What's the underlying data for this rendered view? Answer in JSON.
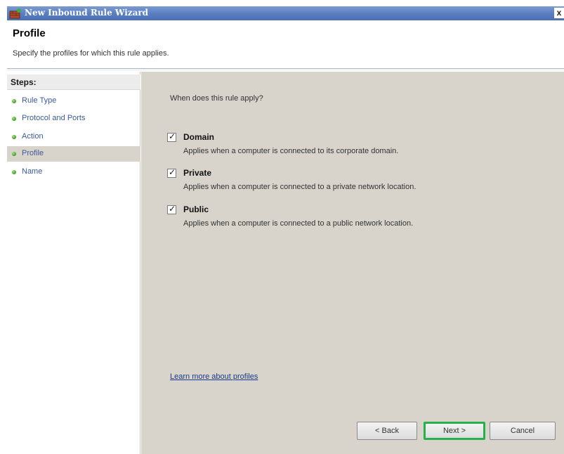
{
  "window": {
    "title": "New Inbound Rule Wizard",
    "close_glyph": "x"
  },
  "header": {
    "title": "Profile",
    "subtitle": "Specify the profiles for which this rule applies."
  },
  "sidebar": {
    "heading": "Steps:",
    "items": [
      {
        "label": "Rule Type",
        "active": false
      },
      {
        "label": "Protocol and Ports",
        "active": false
      },
      {
        "label": "Action",
        "active": false
      },
      {
        "label": "Profile",
        "active": true
      },
      {
        "label": "Name",
        "active": false
      }
    ]
  },
  "main": {
    "question": "When does this rule apply?",
    "profiles": [
      {
        "name": "Domain",
        "checked": true,
        "description": "Applies when a computer is connected to its corporate domain."
      },
      {
        "name": "Private",
        "checked": true,
        "description": "Applies when a computer is connected to a private network location."
      },
      {
        "name": "Public",
        "checked": true,
        "description": "Applies when a computer is connected to a public network location."
      }
    ],
    "learn_more": "Learn more about profiles"
  },
  "buttons": {
    "back": "< Back",
    "next": "Next >",
    "cancel": "Cancel"
  },
  "colors": {
    "titlebar": "#5a7fc2",
    "content_bg": "#d8d4cc",
    "next_highlight": "#28b04b",
    "step_dot": "#4cae2e",
    "link": "#1a3a8a"
  },
  "icons": {
    "app": "firewall-icon",
    "step": "green-dot-icon",
    "check": "checkmark-icon"
  }
}
